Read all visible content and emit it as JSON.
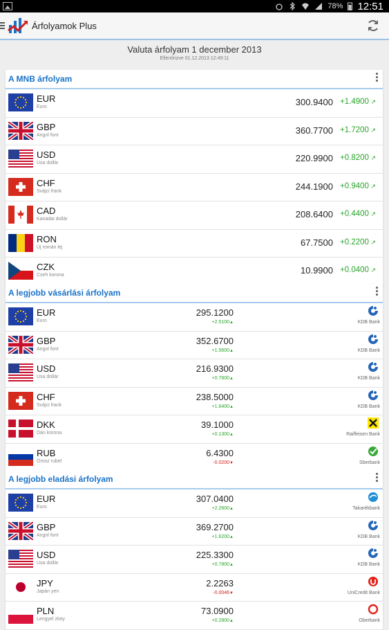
{
  "status": {
    "battery": "78%",
    "time": "12:51"
  },
  "app": {
    "title": "Árfolyamok Plus"
  },
  "header": {
    "title": "Valuta árfolyam 1 december 2013",
    "checked": "Ellenőrizve 01.12.2013 12:49:11"
  },
  "colors": {
    "accent": "#1a73c8",
    "positive": "#2aa32a",
    "negative": "#d02020"
  },
  "mnb": {
    "title": "A MNB árfolyam",
    "rows": [
      {
        "code": "EUR",
        "name": "Euro",
        "rate": "300.9400",
        "change": "+1.4900",
        "flag": "eu-flag-icon"
      },
      {
        "code": "GBP",
        "name": "Angol font",
        "rate": "360.7700",
        "change": "+1.7200",
        "flag": "uk-flag-icon"
      },
      {
        "code": "USD",
        "name": "Usa dollár",
        "rate": "220.9900",
        "change": "+0.8200",
        "flag": "us-flag-icon"
      },
      {
        "code": "CHF",
        "name": "Svájci frank",
        "rate": "244.1900",
        "change": "+0.9400",
        "flag": "ch-flag-icon"
      },
      {
        "code": "CAD",
        "name": "Kanadai dollár",
        "rate": "208.6400",
        "change": "+0.4400",
        "flag": "ca-flag-icon"
      },
      {
        "code": "RON",
        "name": "Új román lej",
        "rate": "67.7500",
        "change": "+0.2200",
        "flag": "ro-flag-icon"
      },
      {
        "code": "CZK",
        "name": "Cseh korona",
        "rate": "10.9900",
        "change": "+0.0400",
        "flag": "cz-flag-icon"
      }
    ]
  },
  "buy": {
    "title": "A legjobb vásárlási árfolyam",
    "rows": [
      {
        "code": "EUR",
        "name": "Euro",
        "rate": "295.1200",
        "change": "+2.5100",
        "bank": "KDB Bank",
        "flag": "eu-flag-icon",
        "banklogo": "kdb-bank-logo-icon"
      },
      {
        "code": "GBP",
        "name": "Angol font",
        "rate": "352.6700",
        "change": "+1.5600",
        "bank": "KDB Bank",
        "flag": "uk-flag-icon",
        "banklogo": "kdb-bank-logo-icon"
      },
      {
        "code": "USD",
        "name": "Usa dollár",
        "rate": "216.9300",
        "change": "+0.7600",
        "bank": "KDB Bank",
        "flag": "us-flag-icon",
        "banklogo": "kdb-bank-logo-icon"
      },
      {
        "code": "CHF",
        "name": "Svájci frank",
        "rate": "238.5000",
        "change": "+1.6400",
        "bank": "KDB Bank",
        "flag": "ch-flag-icon",
        "banklogo": "kdb-bank-logo-icon"
      },
      {
        "code": "DKK",
        "name": "Dán korona",
        "rate": "39.1000",
        "change": "+0.1300",
        "bank": "Raiffeisen Bank",
        "flag": "dk-flag-icon",
        "banklogo": "raiffeisen-logo-icon"
      },
      {
        "code": "RUB",
        "name": "Orosz rubel",
        "rate": "6.4300",
        "change": "-0.0200",
        "bank": "Sberbank",
        "flag": "ru-flag-icon",
        "banklogo": "sberbank-logo-icon"
      }
    ]
  },
  "sell": {
    "title": "A legjobb eladási árfolyam",
    "rows": [
      {
        "code": "EUR",
        "name": "Euro",
        "rate": "307.0400",
        "change": "+2.2600",
        "bank": "Takarékbank",
        "flag": "eu-flag-icon",
        "banklogo": "takarekbank-logo-icon"
      },
      {
        "code": "GBP",
        "name": "Angol font",
        "rate": "369.2700",
        "change": "+1.6200",
        "bank": "KDB Bank",
        "flag": "uk-flag-icon",
        "banklogo": "kdb-bank-logo-icon"
      },
      {
        "code": "USD",
        "name": "Usa dollár",
        "rate": "225.3300",
        "change": "+0.7800",
        "bank": "KDB Bank",
        "flag": "us-flag-icon",
        "banklogo": "kdb-bank-logo-icon"
      },
      {
        "code": "JPY",
        "name": "Japán yen",
        "rate": "2.2263",
        "change": "-0.0046",
        "bank": "UniCredit Bank",
        "flag": "jp-flag-icon",
        "banklogo": "unicredit-logo-icon"
      },
      {
        "code": "PLN",
        "name": "Lengyel zloty",
        "rate": "73.0900",
        "change": "+0.2800",
        "bank": "Oberbank",
        "flag": "pl-flag-icon",
        "banklogo": "oberbank-logo-icon"
      }
    ]
  }
}
